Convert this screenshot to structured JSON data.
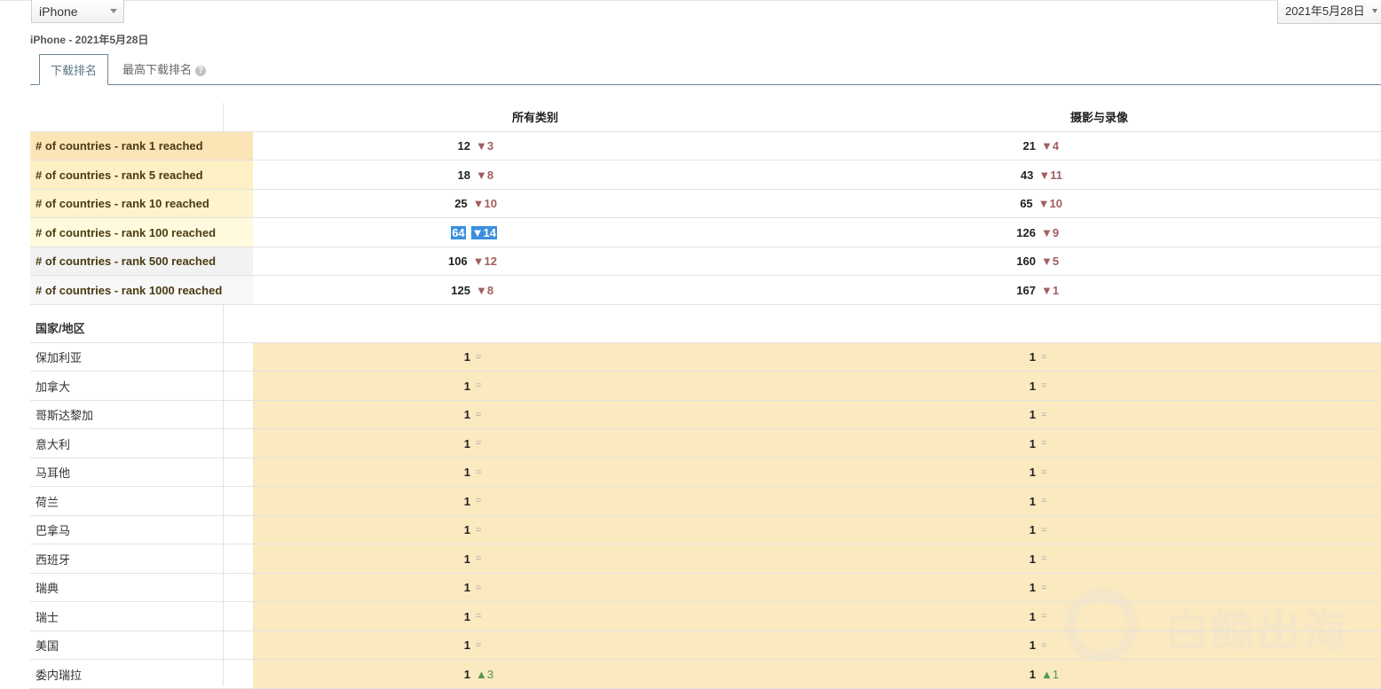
{
  "device_select": {
    "value": "iPhone"
  },
  "date_select": {
    "value": "2021年5月28日"
  },
  "subtitle": "iPhone - 2021年5月28日",
  "tabs": [
    {
      "label": "下载排名",
      "active": true
    },
    {
      "label": "最高下载排名",
      "active": false,
      "help": "?"
    }
  ],
  "columns": [
    "所有类别",
    "摄影与录像"
  ],
  "stats": [
    {
      "label": "# of countries - rank 1 reached",
      "bg": "#fbe4b6",
      "c1": {
        "value": "12",
        "delta": "▼3"
      },
      "c2": {
        "value": "21",
        "delta": "▼4"
      }
    },
    {
      "label": "# of countries - rank 5 reached",
      "bg": "#fdf0c4",
      "c1": {
        "value": "18",
        "delta": "▼8"
      },
      "c2": {
        "value": "43",
        "delta": "▼11"
      }
    },
    {
      "label": "# of countries - rank 10 reached",
      "bg": "#fdf4cc",
      "c1": {
        "value": "25",
        "delta": "▼10"
      },
      "c2": {
        "value": "65",
        "delta": "▼10"
      }
    },
    {
      "label": "# of countries - rank 100 reached",
      "bg": "#fffadd",
      "c1": {
        "value": "64",
        "delta": "▼14",
        "selected": true
      },
      "c2": {
        "value": "126",
        "delta": "▼9"
      }
    },
    {
      "label": "# of countries - rank 500 reached",
      "bg": "#f2f2f2",
      "c1": {
        "value": "106",
        "delta": "▼12"
      },
      "c2": {
        "value": "160",
        "delta": "▼5"
      }
    },
    {
      "label": "# of countries - rank 1000 reached",
      "bg": "#f7f7f7",
      "c1": {
        "value": "125",
        "delta": "▼8"
      },
      "c2": {
        "value": "167",
        "delta": "▼1"
      }
    }
  ],
  "country_header": "国家/地区",
  "countries": [
    {
      "name": "保加利亚",
      "c1": {
        "value": "1",
        "delta": "="
      },
      "c2": {
        "value": "1",
        "delta": "="
      }
    },
    {
      "name": "加拿大",
      "c1": {
        "value": "1",
        "delta": "="
      },
      "c2": {
        "value": "1",
        "delta": "="
      }
    },
    {
      "name": "哥斯达黎加",
      "c1": {
        "value": "1",
        "delta": "="
      },
      "c2": {
        "value": "1",
        "delta": "="
      }
    },
    {
      "name": "意大利",
      "c1": {
        "value": "1",
        "delta": "="
      },
      "c2": {
        "value": "1",
        "delta": "="
      }
    },
    {
      "name": "马耳他",
      "c1": {
        "value": "1",
        "delta": "="
      },
      "c2": {
        "value": "1",
        "delta": "="
      }
    },
    {
      "name": "荷兰",
      "c1": {
        "value": "1",
        "delta": "="
      },
      "c2": {
        "value": "1",
        "delta": "="
      }
    },
    {
      "name": "巴拿马",
      "c1": {
        "value": "1",
        "delta": "="
      },
      "c2": {
        "value": "1",
        "delta": "="
      }
    },
    {
      "name": "西班牙",
      "c1": {
        "value": "1",
        "delta": "="
      },
      "c2": {
        "value": "1",
        "delta": "="
      }
    },
    {
      "name": "瑞典",
      "c1": {
        "value": "1",
        "delta": "="
      },
      "c2": {
        "value": "1",
        "delta": "="
      }
    },
    {
      "name": "瑞士",
      "c1": {
        "value": "1",
        "delta": "="
      },
      "c2": {
        "value": "1",
        "delta": "="
      }
    },
    {
      "name": "美国",
      "c1": {
        "value": "1",
        "delta": "="
      },
      "c2": {
        "value": "1",
        "delta": "="
      }
    },
    {
      "name": "委内瑞拉",
      "c1": {
        "value": "1",
        "delta": "▲3"
      },
      "c2": {
        "value": "1",
        "delta": "▲1"
      }
    }
  ],
  "watermark": {
    "text": "白鲸出海"
  }
}
